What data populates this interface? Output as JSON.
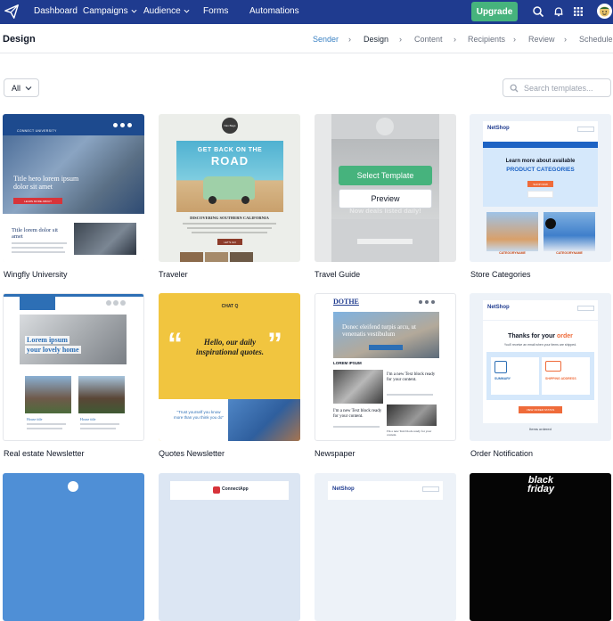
{
  "nav": {
    "items": [
      {
        "label": "Dashboard",
        "dropdown": false
      },
      {
        "label": "Campaigns",
        "dropdown": true
      },
      {
        "label": "Audience",
        "dropdown": true
      },
      {
        "label": "Forms",
        "dropdown": false
      },
      {
        "label": "Automations",
        "dropdown": false
      }
    ],
    "upgrade_label": "Upgrade",
    "icons": [
      "search-icon",
      "bell-icon",
      "apps-grid-icon"
    ]
  },
  "page": {
    "title": "Design",
    "steps": [
      {
        "label": "Sender",
        "state": "done"
      },
      {
        "label": "Design",
        "state": "active"
      },
      {
        "label": "Content",
        "state": "todo"
      },
      {
        "label": "Recipients",
        "state": "todo"
      },
      {
        "label": "Review",
        "state": "todo"
      },
      {
        "label": "Schedule",
        "state": "todo"
      }
    ]
  },
  "filter": {
    "selected": "All"
  },
  "search": {
    "placeholder": "Search templates..."
  },
  "templates": [
    {
      "name": "Wingfly University",
      "thumb": {
        "header": "CONNECT UNIVERSITY",
        "hero": "Title hero lorem ipsum dolor sit amet",
        "cta": "LEARN MORE ABOUT",
        "sub": "Title lorem dolor sit amet"
      }
    },
    {
      "name": "Traveler",
      "thumb": {
        "logo": "Nav Bags",
        "hero_line1": "GET BACK ON THE",
        "hero_line2": "ROAD",
        "sub": "DISCOVERING SOUTHERN CALIFORNIA",
        "cta": "LET'S GO"
      }
    },
    {
      "name": "Travel Guide",
      "thumb": {
        "behind": "Now deals listed daily!"
      },
      "hover": {
        "select": "Select Template",
        "preview": "Preview"
      }
    },
    {
      "name": "Store Categories",
      "thumb": {
        "brand": "NetShop",
        "hero_line1": "Learn more about available",
        "hero_line2": "PRODUCT CATEGORIES",
        "cta": "SHOP NOW",
        "cat1": "CATEGORYNAME",
        "cat2": "CATEGORYNAME"
      }
    },
    {
      "name": "Real estate Newsletter",
      "thumb": {
        "hero_line1": "Lorem ipsum",
        "hero_line2": "your lovely home",
        "house1": "House title",
        "house2": "House title"
      }
    },
    {
      "name": "Quotes Newsletter",
      "thumb": {
        "brand": "CHAT Q",
        "quote": "Hello, our daily inspirational quotes.",
        "small_quote": "\"Trust yourself you know more than you think you do\""
      }
    },
    {
      "name": "Newspaper",
      "thumb": {
        "masthead": "DOTHE",
        "hero": "Donec eleifend turpis arcu, ut venenatis vestibulum",
        "section": "LOREM IPSUM",
        "story1": "I'm a new Text block ready for your content.",
        "story2": "I'm a new Text block ready for your content.",
        "story3": "I'm a new Text block ready for your content."
      }
    },
    {
      "name": "Order Notification",
      "thumb": {
        "brand": "NetShop",
        "title1": "Thanks for your",
        "title2": "order",
        "sub": "You'll receive an email when your items are shipped.",
        "box1": "SUMMARY",
        "box2": "SHIPPING ADDRESS",
        "cta": "VIEW ORDER STATUS",
        "footer": "Items ordered"
      }
    }
  ],
  "bottom_row": [
    {
      "thumb": "blue"
    },
    {
      "thumb": "ConnectApp"
    },
    {
      "thumb": "NetShop"
    },
    {
      "thumb": "black friday"
    }
  ],
  "colors": {
    "topbar": "#1f3b8f",
    "upgrade": "#46b37d",
    "accent": "#3b82c4"
  }
}
